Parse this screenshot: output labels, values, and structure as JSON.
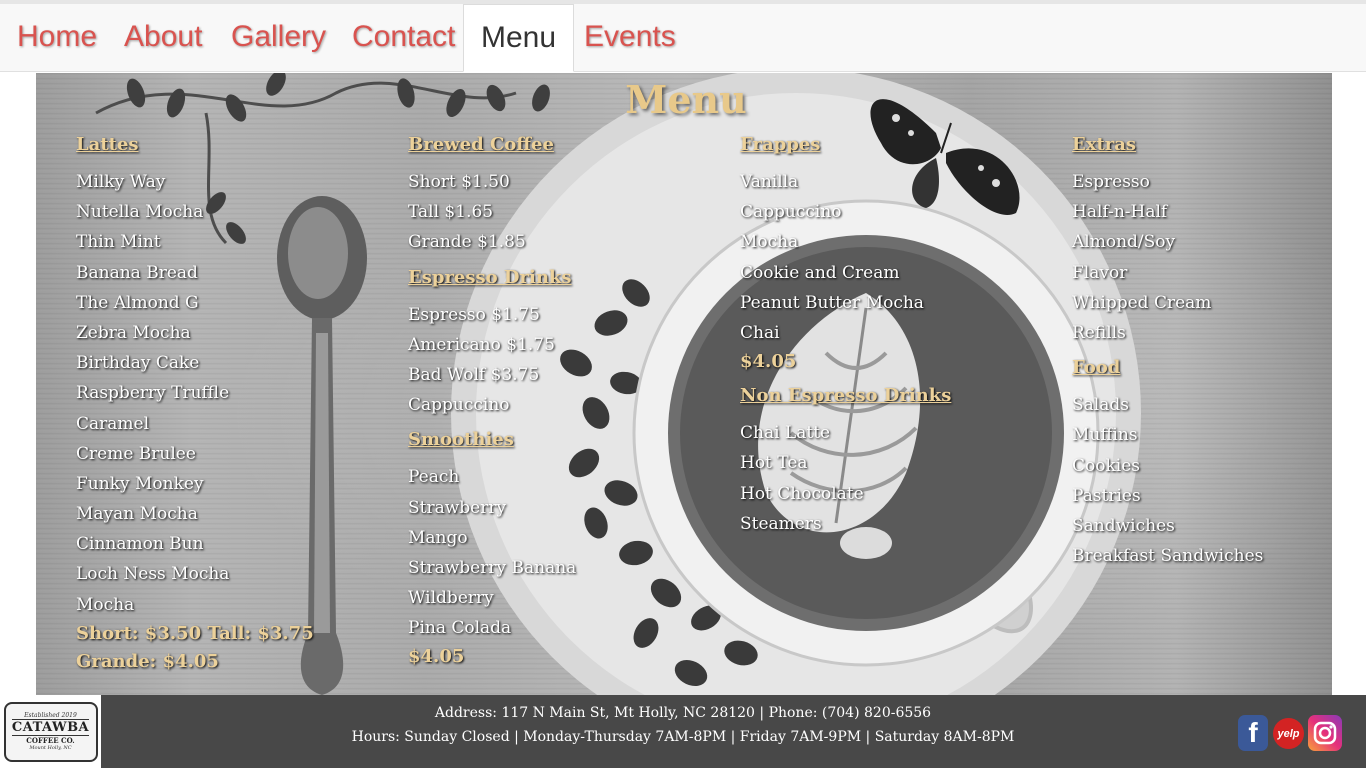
{
  "nav": {
    "items": [
      {
        "label": "Home"
      },
      {
        "label": "About"
      },
      {
        "label": "Gallery"
      },
      {
        "label": "Contact"
      },
      {
        "label": "Menu",
        "active": true
      },
      {
        "label": "Events"
      }
    ]
  },
  "board": {
    "title": "Menu",
    "lattes": {
      "heading": "Lattes",
      "items": [
        "Milky Way",
        "Nutella Mocha",
        "Thin Mint",
        "Banana Bread",
        "The Almond G",
        "Zebra Mocha",
        "Birthday Cake",
        "Raspberry Truffle",
        "Caramel",
        "Creme Brulee",
        "Funky Monkey",
        "Mayan Mocha",
        "Cinnamon Bun",
        "Loch Ness Mocha",
        "Mocha"
      ],
      "price_line1": "Short: $3.50 Tall: $3.75",
      "price_line2": "Grande: $4.05"
    },
    "brewed_coffee": {
      "heading": "Brewed Coffee",
      "items": [
        "Short $1.50",
        "Tall $1.65",
        "Grande $1.85"
      ]
    },
    "espresso_drinks": {
      "heading": "Espresso Drinks",
      "items": [
        "Espresso $1.75",
        "Americano $1.75",
        "Bad Wolf $3.75",
        "Cappuccino"
      ]
    },
    "smoothies": {
      "heading": "Smoothies",
      "items": [
        "Peach",
        "Strawberry",
        "Mango",
        "Strawberry Banana",
        "Wildberry",
        "Pina Colada"
      ],
      "price": "$4.05"
    },
    "frappes": {
      "heading": "Frappes",
      "items": [
        "Vanilla",
        "Cappuccino",
        "Mocha",
        "Cookie and Cream",
        "Peanut Butter Mocha",
        "Chai"
      ],
      "price": "$4.05"
    },
    "non_espresso": {
      "heading": "Non Espresso Drinks",
      "items": [
        "Chai Latte",
        "Hot Tea",
        "Hot Chocolate",
        "Steamers"
      ]
    },
    "extras": {
      "heading": "Extras",
      "items": [
        "Espresso",
        "Half-n-Half",
        "Almond/Soy",
        "Flavor",
        "Whipped Cream",
        "Refills"
      ]
    },
    "food": {
      "heading": "Food",
      "items": [
        "Salads",
        "Muffins",
        "Cookies",
        "Pastries",
        "Sandwiches",
        "Breakfast Sandwiches"
      ]
    }
  },
  "footer": {
    "logo": {
      "established": "Established 2019",
      "name": "CATAWBA",
      "sub": "COFFEE CO.",
      "location": "Mount Holly, NC"
    },
    "address_line": "Address: 117 N Main St, Mt Holly, NC 28120 | Phone: (704) 820-6556",
    "hours_line": "Hours: Sunday Closed | Monday-Thursday 7AM-8PM | Friday 7AM-9PM | Saturday 8AM-8PM",
    "social": {
      "facebook_glyph": "f",
      "yelp_glyph": "yelp"
    }
  },
  "colors": {
    "nav_link": "#d9534f",
    "heading_gold": "#ecd19a",
    "footer_bg": "#484848"
  }
}
